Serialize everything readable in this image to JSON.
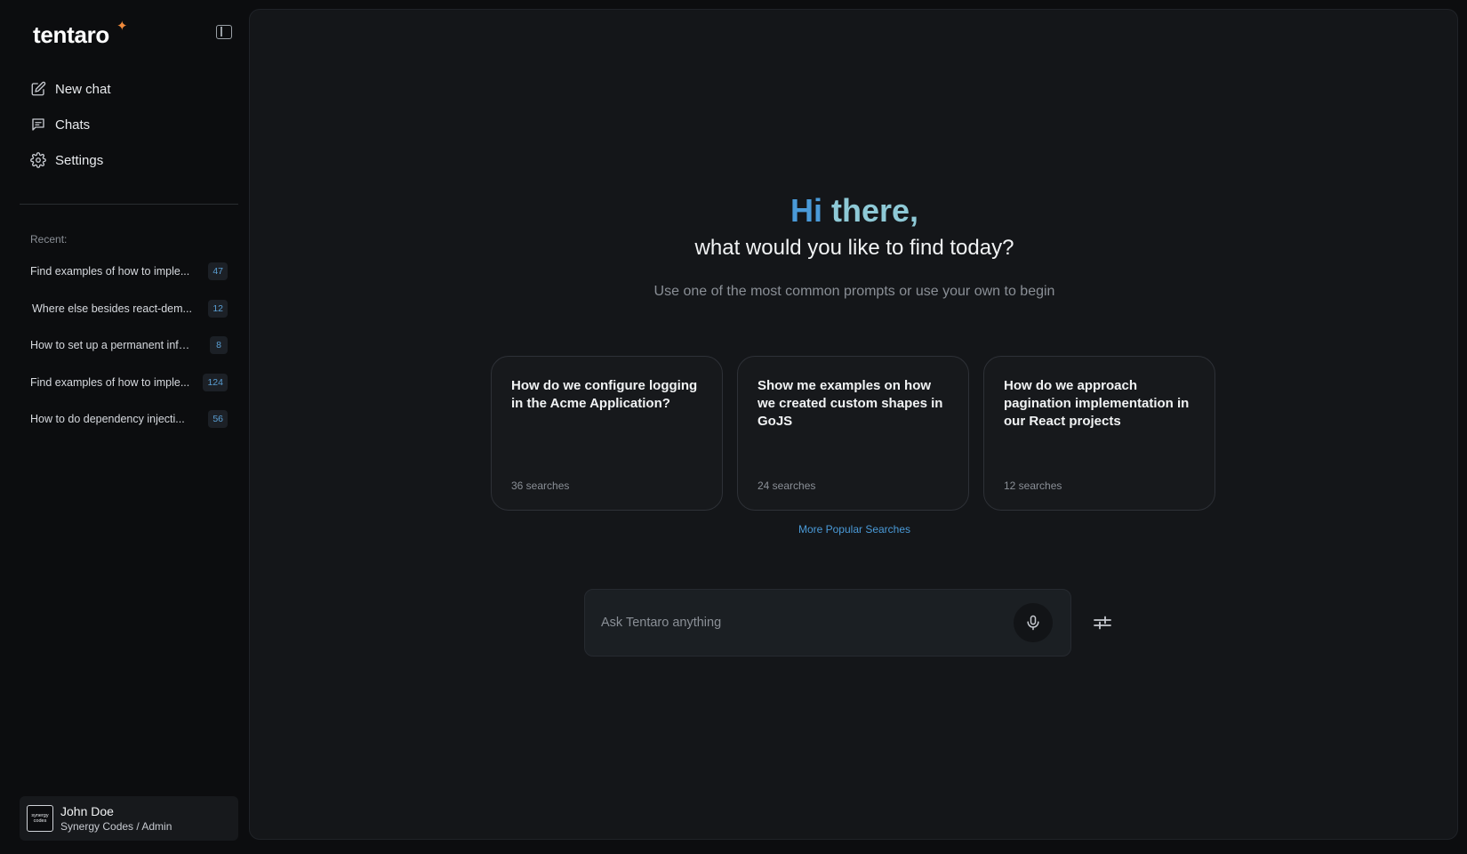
{
  "brand": {
    "name": "tentaro",
    "star": "✦"
  },
  "nav": {
    "items": [
      {
        "label": "New chat",
        "icon": "edit-icon"
      },
      {
        "label": "Chats",
        "icon": "chat-icon"
      },
      {
        "label": "Settings",
        "icon": "gear-icon"
      }
    ]
  },
  "recent": {
    "label": "Recent:",
    "items": [
      {
        "text": "Find examples of how to imple...",
        "count": "47"
      },
      {
        "text": "Where else besides react-dem...",
        "count": "12"
      },
      {
        "text": "How to set up a permanent info...",
        "count": "8"
      },
      {
        "text": "Find examples of how to imple...",
        "count": "124"
      },
      {
        "text": "How to do dependency injecti...",
        "count": "56"
      }
    ]
  },
  "user": {
    "name": "John Doe",
    "role": "Synergy Codes / Admin",
    "avatar_text": "synergy codes"
  },
  "greeting": {
    "hi": "Hi",
    "there": "there,",
    "subtitle": "what would you like to find today?",
    "hint": "Use one of the most common prompts or use your own to begin"
  },
  "cards": [
    {
      "title": "How do we configure logging in the Acme Application?",
      "count": "36 searches"
    },
    {
      "title": "Show me examples on how we created custom shapes in GoJS",
      "count": "24 searches"
    },
    {
      "title": "How do we approach pagination implementation in our React projects",
      "count": "12 searches"
    }
  ],
  "more_link": "More Popular Searches",
  "ask": {
    "placeholder": "Ask Tentaro anything",
    "value": ""
  },
  "colors": {
    "accent": "#4a9ad8",
    "accent_teal": "#8ec9d6",
    "brand_star": "#f08a3c",
    "background": "#0c0d0f",
    "panel": "#141619"
  }
}
